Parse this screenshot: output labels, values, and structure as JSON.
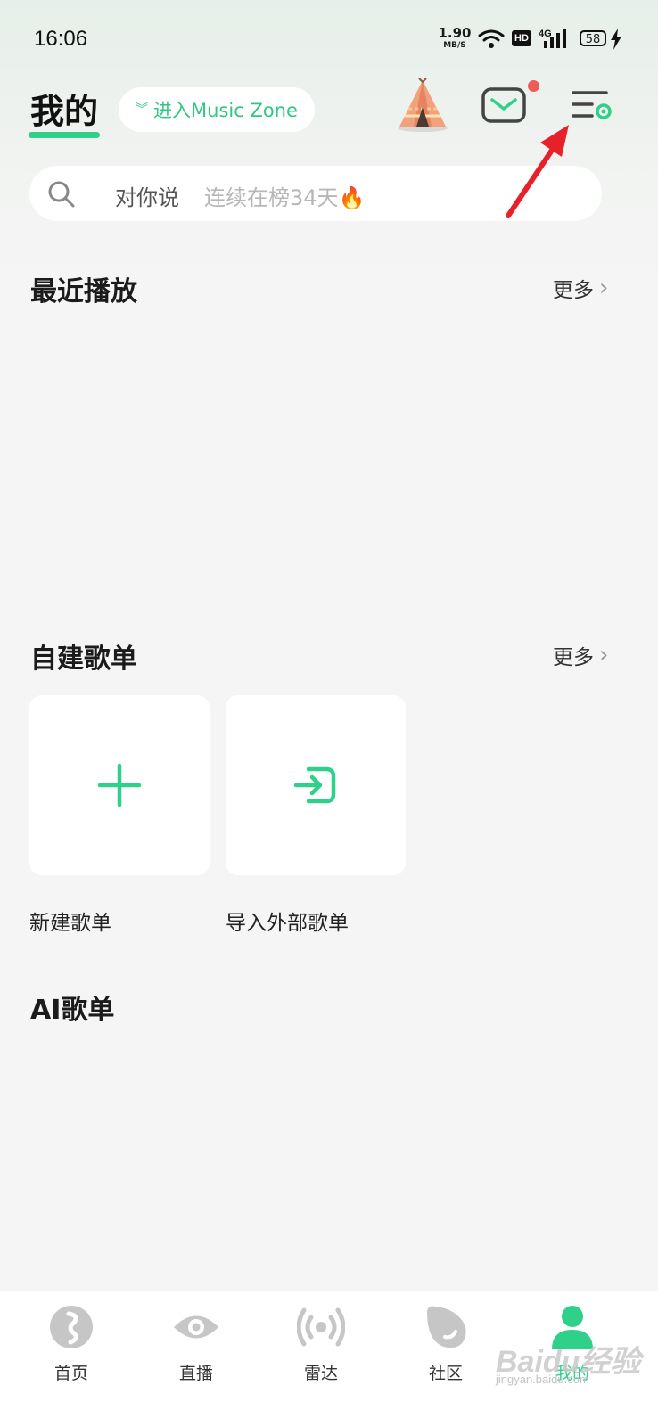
{
  "status_bar": {
    "time": "16:06",
    "net_speed": "1.90",
    "net_unit": "MB/S",
    "hd": "HD",
    "network": "4G",
    "battery": "58"
  },
  "header": {
    "title": "我的",
    "zone_button": "进入Music Zone",
    "accent_color": "#2fd08a"
  },
  "search": {
    "label": "对你说",
    "placeholder": "连续在榜34天🔥"
  },
  "recent": {
    "title": "最近播放",
    "more": "更多"
  },
  "playlists": {
    "title": "自建歌单",
    "more": "更多",
    "cards": [
      {
        "label": "新建歌单",
        "icon": "plus-icon"
      },
      {
        "label": "导入外部歌单",
        "icon": "import-icon"
      }
    ]
  },
  "ai": {
    "title": "AI歌单"
  },
  "bottom_nav": {
    "items": [
      {
        "label": "首页",
        "icon": "music-note-icon"
      },
      {
        "label": "直播",
        "icon": "eye-icon"
      },
      {
        "label": "雷达",
        "icon": "radar-icon"
      },
      {
        "label": "社区",
        "icon": "community-icon"
      },
      {
        "label": "我的",
        "icon": "person-icon"
      }
    ]
  },
  "watermark": {
    "text": "Baidu经验",
    "url": "jingyan.baidu.com"
  }
}
